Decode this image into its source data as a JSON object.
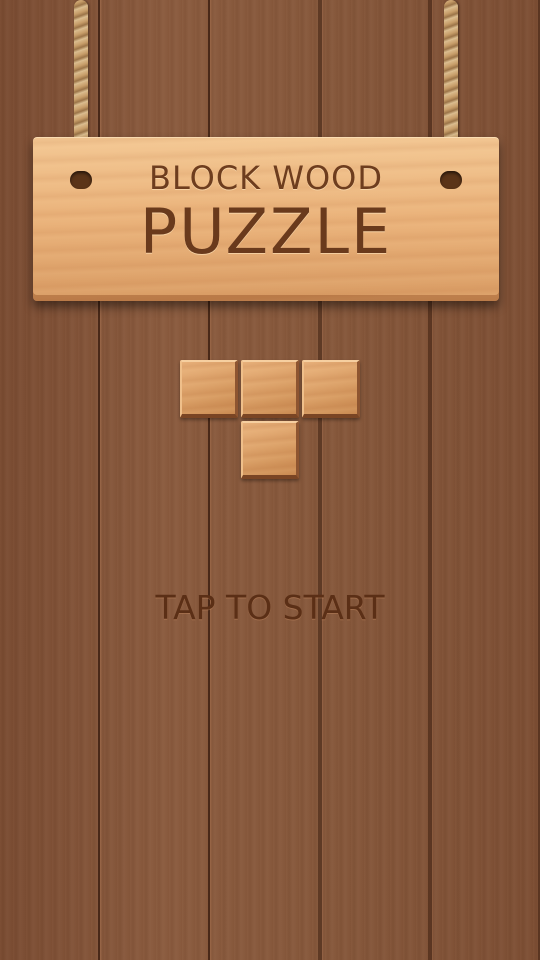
{
  "title": {
    "line1": "BLOCK WOOD",
    "line2": "PUZZLE"
  },
  "start_prompt": "TAP TO START",
  "logo_piece": {
    "shape": "T-tetromino",
    "cells": [
      [
        0,
        0
      ],
      [
        0,
        1
      ],
      [
        0,
        2
      ],
      [
        1,
        1
      ]
    ]
  },
  "colors": {
    "background_wood": "#85563a",
    "sign_wood": "#ebb47c",
    "title_text": "#6a3a1c",
    "prompt_text": "#5b2f16",
    "rope": "#c69c68"
  }
}
